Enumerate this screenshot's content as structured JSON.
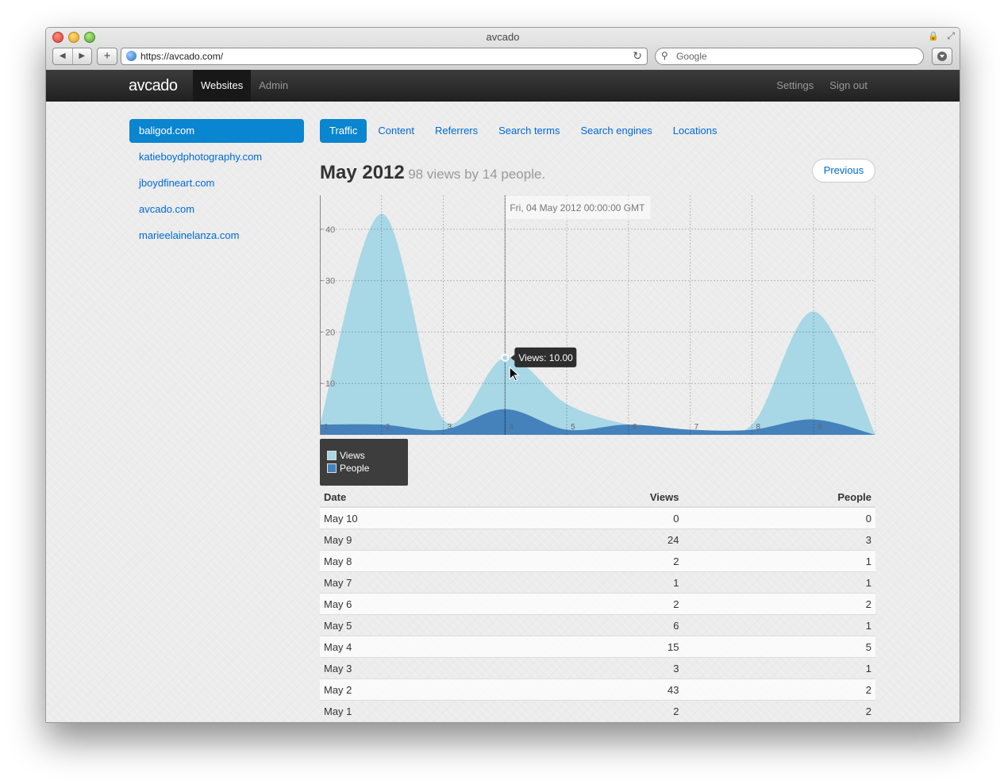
{
  "browser": {
    "title": "avcado",
    "url": "https://avcado.com/",
    "search_placeholder": "Google",
    "back": "◀",
    "forward": "▶",
    "add": "+",
    "reload": "↻",
    "lock": "🔒",
    "expand": "⤢"
  },
  "topbar": {
    "brand": "avcado",
    "nav": [
      "Websites",
      "Admin"
    ],
    "right": [
      "Settings",
      "Sign out"
    ]
  },
  "sidebar": {
    "sites": [
      "baligod.com",
      "katieboydphotography.com",
      "jboydfineart.com",
      "avcado.com",
      "marieelainelanza.com"
    ],
    "active_index": 0
  },
  "tabs": [
    "Traffic",
    "Content",
    "Referrers",
    "Search terms",
    "Search engines",
    "Locations"
  ],
  "heading": {
    "month": "May 2012",
    "summary": "98 views by 14 people."
  },
  "previous_button": "Previous",
  "chart_data": {
    "type": "area",
    "x": [
      1,
      2,
      3,
      4,
      5,
      6,
      7,
      8,
      9,
      10
    ],
    "series": [
      {
        "name": "Views",
        "values": [
          2,
          43,
          3,
          15,
          6,
          2,
          1,
          2,
          24,
          0
        ],
        "color": "#a8d7e6"
      },
      {
        "name": "People",
        "values": [
          2,
          2,
          1,
          5,
          1,
          2,
          1,
          1,
          3,
          0
        ],
        "color": "#4582bb"
      }
    ],
    "ylim": [
      0,
      46
    ],
    "yticks": [
      10,
      20,
      30,
      40
    ],
    "xticks": [
      1,
      2,
      3,
      4,
      5,
      6,
      7,
      8,
      9
    ],
    "grid": true,
    "hover": {
      "date_label": "Fri, 04 May 2012 00:00:00 GMT",
      "tooltip": "Views: 10.00",
      "x": 4,
      "y": 15
    },
    "legend": [
      "Views",
      "People"
    ]
  },
  "table": {
    "headers": [
      "Date",
      "Views",
      "People"
    ],
    "rows": [
      [
        "May 10",
        "0",
        "0"
      ],
      [
        "May 9",
        "24",
        "3"
      ],
      [
        "May 8",
        "2",
        "1"
      ],
      [
        "May 7",
        "1",
        "1"
      ],
      [
        "May 6",
        "2",
        "2"
      ],
      [
        "May 5",
        "6",
        "1"
      ],
      [
        "May 4",
        "15",
        "5"
      ],
      [
        "May 3",
        "3",
        "1"
      ],
      [
        "May 2",
        "43",
        "2"
      ],
      [
        "May 1",
        "2",
        "2"
      ]
    ]
  }
}
